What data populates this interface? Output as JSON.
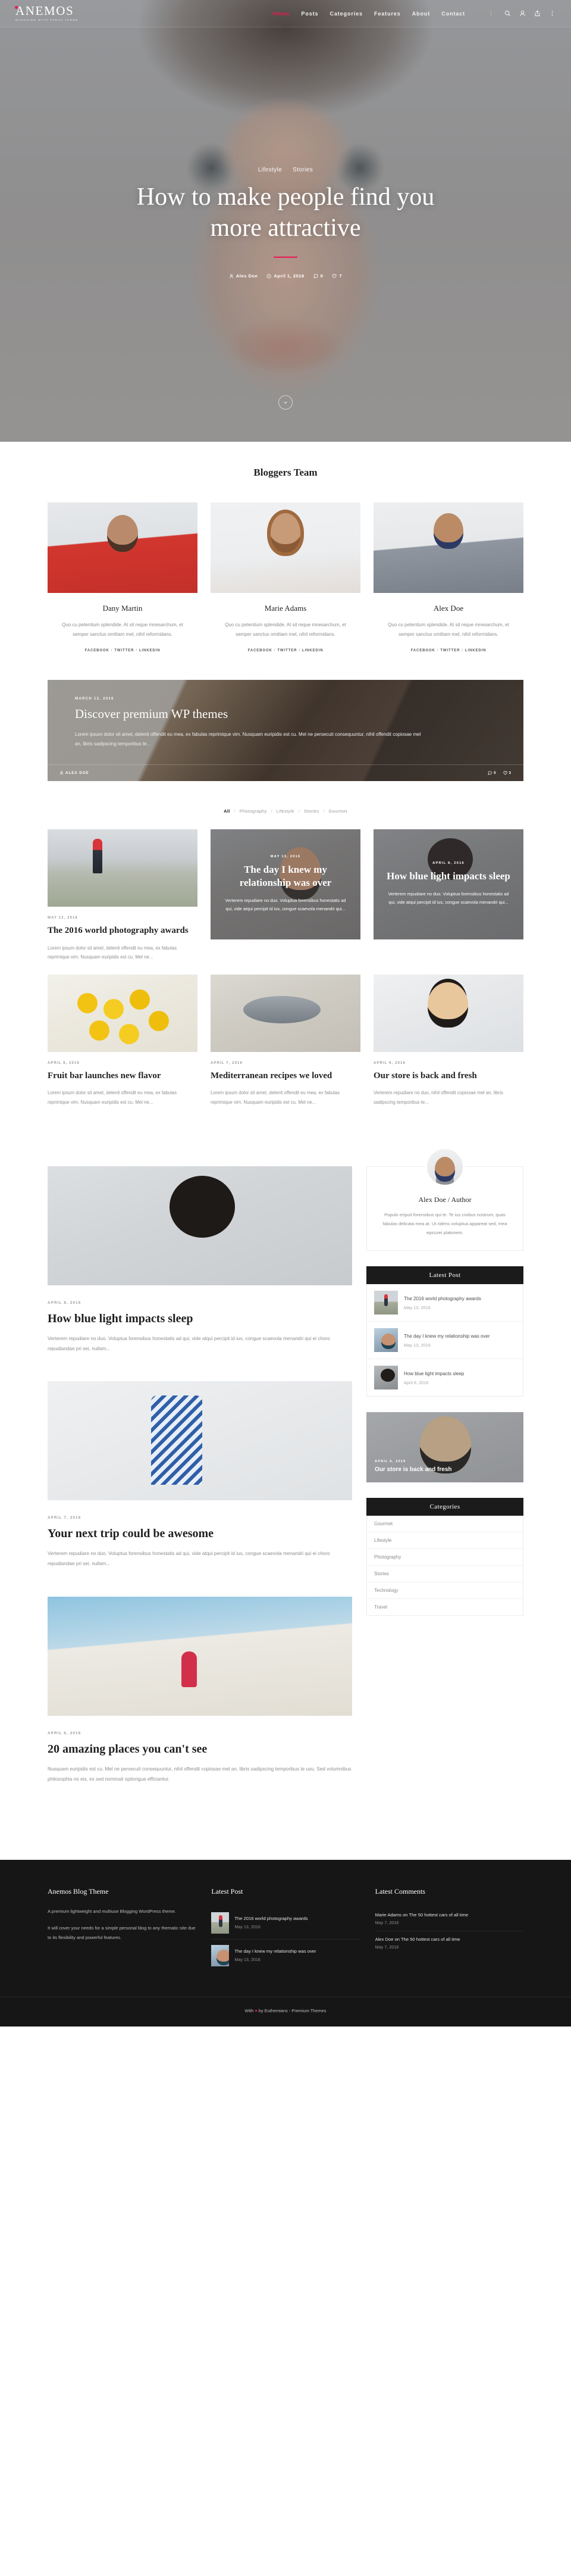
{
  "brand": {
    "name": "ANEMOS",
    "tagline": "BLOGGING WITH FRESH THEME",
    "accent": "#ed1651"
  },
  "nav": {
    "items": [
      {
        "label": "Home",
        "active": true
      },
      {
        "label": "Posts",
        "active": false
      },
      {
        "label": "Categories",
        "active": false
      },
      {
        "label": "Features",
        "active": false
      },
      {
        "label": "About",
        "active": false
      },
      {
        "label": "Contact",
        "active": false
      }
    ],
    "icons": [
      "search-icon",
      "user-icon",
      "share-icon",
      "more-icon"
    ]
  },
  "hero": {
    "categories": [
      "Lifestyle",
      "Stories"
    ],
    "title": "How to make people find you more attractive",
    "author": "Alex Doe",
    "date": "April 1, 2016",
    "comments": "0",
    "likes": "7"
  },
  "team": {
    "title": "Bloggers Team",
    "members": [
      {
        "name": "Dany Martin",
        "bio": "Quo cu petentium splendide. At sit reque mnesarchum, et semper sanctus omittam mel, nihil reformidans.",
        "social": [
          "FACEBOOK",
          "TWITTER",
          "LINKEDIN"
        ]
      },
      {
        "name": "Marie Adams",
        "bio": "Quo cu petentium splendide. At sit reque mnesarchum, et semper sanctus omittam mel, nihil reformidans.",
        "social": [
          "FACEBOOK",
          "TWITTER",
          "LINKEDIN"
        ]
      },
      {
        "name": "Alex Doe",
        "bio": "Quo cu petentium splendide. At sit reque mnesarchum, et semper sanctus omittam mel, nihil reformidans.",
        "social": [
          "FACEBOOK",
          "TWITTER",
          "LINKEDIN"
        ]
      }
    ]
  },
  "promo": {
    "date": "MARCH 12, 2016",
    "title": "Discover premium WP themes",
    "excerpt": "Lorem ipsum dolor sit amet, delenit offendit eu mea, ex fabulas reprimique vim. Nusquam euripidis est cu. Mel ne persecuti consequuntur, nihil offendit copiosae mel an, libris sadipscing temporibus te...",
    "author": "ALEX DOE",
    "comments": "0",
    "likes": "3"
  },
  "filters": {
    "items": [
      "All",
      "Photography",
      "Lifestyle",
      "Stories",
      "Gourmet"
    ],
    "active": "All"
  },
  "grid": [
    {
      "style": "light",
      "date": "MAY 13, 2016",
      "title": "The 2016 world photography awards",
      "excerpt": "Lorem ipsum dolor sit amet, delenit offendit eu mea, ex fabulas reprimique vim. Nusquam euripidis est cu. Mel ne..."
    },
    {
      "style": "overlay",
      "date": "MAY 13, 2016",
      "title": "The day I knew my relationship was over",
      "excerpt": "Verterem repudiare no duo. Voluptua forensibus honestatis ad qui, vide atqui percipit id ius, congue scaevola menandri qui..."
    },
    {
      "style": "overlay",
      "date": "APRIL 8, 2016",
      "title": "How blue light impacts sleep",
      "excerpt": "Verterem repudiare no duo. Voluptua forensibus honestatis ad qui, vide atqui percipit id ius, congue scaevola menandri qui..."
    },
    {
      "style": "light",
      "date": "APRIL 8, 2016",
      "title": "Fruit bar launches new flavor",
      "excerpt": "Lorem ipsum dolor sit amet, delenit offendit eu mea, ex fabulas reprimique vim. Nusquam euripidis est cu. Mel ne..."
    },
    {
      "style": "light",
      "date": "APRIL 7, 2016",
      "title": "Mediterranean recipes we loved",
      "excerpt": "Lorem ipsum dolor sit amet, delenit offendit eu mea, ex fabulas reprimique vim. Nusquam euripidis est cu. Mel ne..."
    },
    {
      "style": "light",
      "date": "APRIL 6, 2016",
      "title": "Our store is back and fresh",
      "excerpt": "Verterem repudiare no duo, nihil offendit copiosae mel an, libris sadipscing temporibus te..."
    }
  ],
  "blog": [
    {
      "date": "APRIL 8, 2016",
      "title": "How blue light impacts sleep",
      "excerpt": "Verterem repudiare no duo. Voluptua forensibus honestatis ad qui, vide atqui percipit id ius, congue scaevola menandri qui ei choro repudiandae pri sei, nullam..."
    },
    {
      "date": "APRIL 7, 2016",
      "title": "Your next trip could be awesome",
      "excerpt": "Verterem repudiare no duo. Voluptua forensibus honestatis ad qui, vide atqui percipit id ius, congue scaevola menandri qui ei choro repudiandae pri sei, nullam..."
    },
    {
      "date": "APRIL 6, 2016",
      "title": "20 amazing places you can't see",
      "excerpt": "Nusquam euripidis est cu. Mel ne persecuti consequuntur, nihil offendit copiosae mel an, libris sadipscing temporibus te usu. Sed volumnibus philosophia no eis, ex sed nominati optiongue efficiantur."
    }
  ],
  "sidebar": {
    "author": {
      "name": "Alex Doe / Author",
      "bio": "Populo eripuit forensibus qui te. Te ius civibus nostrum, quas fabulas delicata mea at. Ut ridens voluptua appareat sed, mea epicurei platonem."
    },
    "latest_post": {
      "title": "Latest Post",
      "items": [
        {
          "name": "The 2016 world photography awards",
          "date": "May 13, 2016"
        },
        {
          "name": "The day I knew my relationship was over",
          "date": "May 13, 2016"
        },
        {
          "name": "How blue light impacts sleep",
          "date": "April 8, 2016"
        }
      ]
    },
    "promo_mini": {
      "date": "APRIL 6, 2016",
      "title": "Our store is back and fresh"
    },
    "categories": {
      "title": "Categories",
      "items": [
        "Gourmet",
        "Lifestyle",
        "Photography",
        "Stories",
        "Technology",
        "Travel"
      ]
    }
  },
  "footer": {
    "about": {
      "title": "Anemos Blog Theme",
      "p1": "A premium lightweight and multiuse Blogging WordPress theme.",
      "p2": "It will cover your needs for a simple personal blog to any thematic site due to its flexibility and powerful features."
    },
    "latest_post": {
      "title": "Latest Post",
      "items": [
        {
          "name": "The 2016 world photography awards",
          "date": "May 13, 2016"
        },
        {
          "name": "The day I knew my relationship was over",
          "date": "May 13, 2016"
        }
      ]
    },
    "latest_comments": {
      "title": "Latest Comments",
      "items": [
        {
          "name": "Marie Adams on The 50 hottest cars of all time",
          "date": "May 7, 2016"
        },
        {
          "name": "Alex Doe on The 50 hottest cars of all time",
          "date": "May 7, 2016"
        }
      ]
    },
    "copyright_before": "With",
    "copyright_after": "by Euthemians - Premium Themes"
  }
}
